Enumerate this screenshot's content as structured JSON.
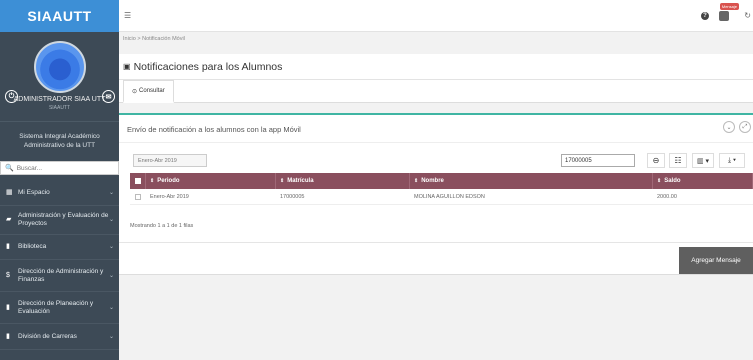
{
  "app": {
    "brand": "SIAAUTT"
  },
  "profile": {
    "name": "ADMINISTRADOR SIAA UTT",
    "role": "SIAAUTT"
  },
  "sidebar": {
    "system_name": "Sistema Integral Académico Administrativo de la UTT",
    "search_placeholder": "Buscar...",
    "items": [
      {
        "label": "Mi Espacio"
      },
      {
        "label": "Administración y Evaluación de Proyectos"
      },
      {
        "label": "Biblioteca"
      },
      {
        "label": "Dirección de Administración y Finanzas"
      },
      {
        "label": "Dirección de Planeación y Evaluación"
      },
      {
        "label": "División de Carreras"
      }
    ]
  },
  "topbar": {
    "notification_badge": "Mensaje"
  },
  "breadcrumb": "Inicio > Notificación Móvil",
  "page": {
    "title": "Notificaciones para los Alumnos"
  },
  "tabs": [
    {
      "label": "Consultar"
    }
  ],
  "panel": {
    "title": "Envío de notificación a los alumnos con la app Móvil",
    "period_filter": "Enero-Abr 2019",
    "search_value": "17000005",
    "columns": [
      "Periodo",
      "Matrícula",
      "Nombre",
      "Saldo"
    ],
    "rows": [
      {
        "periodo": "Enero-Abr 2019",
        "matricula": "17000005",
        "nombre": "MOLINA AGUILLON EDSON",
        "saldo": "2000.00"
      }
    ],
    "info": "Mostrando 1 a 1 de 1 filas",
    "add_button": "Agregar Mensaje"
  },
  "colors": {
    "brand": "#3d8fd6",
    "sidebar": "#3d4a56",
    "table_header": "#8a4f5e",
    "panel_accent": "#3fb5a3"
  },
  "icons": [
    "power-icon",
    "message-icon",
    "search-icon",
    "menu-toggle-icon",
    "help-icon",
    "notification-icon",
    "refresh-icon"
  ]
}
